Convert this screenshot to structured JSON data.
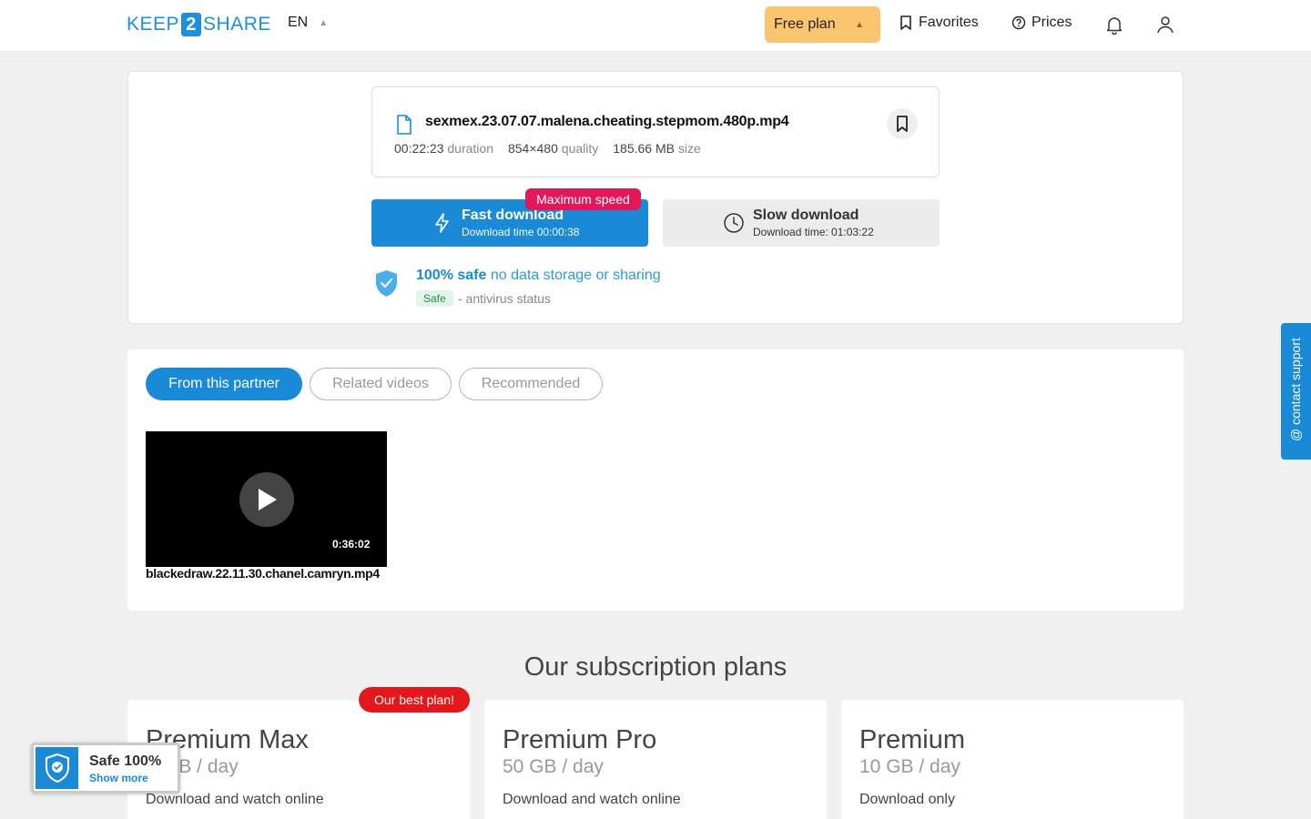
{
  "header": {
    "logo_left": "KEEP",
    "logo_num": "2",
    "logo_right": "SHARE",
    "lang": "EN",
    "plan_label": "Free plan",
    "favorites": "Favorites",
    "prices": "Prices"
  },
  "file": {
    "name": "sexmex.23.07.07.malena.cheating.stepmom.480p.mp4",
    "duration_value": "00:22:23",
    "duration_label": "duration",
    "quality_value": "854×480",
    "quality_label": "quality",
    "size_value": "185.66 MB",
    "size_label": "size"
  },
  "download": {
    "fast_title": "Fast download",
    "fast_sub": "Download time 00:00:38",
    "max_badge": "Maximum speed",
    "slow_title": "Slow download",
    "slow_sub": "Download time: 01:03:22"
  },
  "safety": {
    "bold": "100% safe",
    "rest": "no data storage or sharing",
    "tag": "Safe",
    "status": "- antivirus status"
  },
  "tabs": [
    {
      "label": "From this partner",
      "active": true
    },
    {
      "label": "Related videos",
      "active": false
    },
    {
      "label": "Recommended",
      "active": false
    }
  ],
  "video": {
    "duration": "0:36:02",
    "title": "blackedraw.22.11.30.chanel.camryn.mp4"
  },
  "plans": {
    "title": "Our subscription plans",
    "best_badge": "Our best plan!",
    "items": [
      {
        "name": "Premium Max",
        "quota": "GB / day",
        "desc": "Download and watch online"
      },
      {
        "name": "Premium Pro",
        "quota": "50 GB / day",
        "desc": "Download and watch online"
      },
      {
        "name": "Premium",
        "quota": "10 GB / day",
        "desc": "Download only"
      }
    ]
  },
  "contact": "@ contact support",
  "safe_widget": {
    "title": "Safe 100%",
    "link": "Show more"
  },
  "colors": {
    "primary": "#1a8ad6",
    "plan_button": "#fbc46e",
    "badge_red": "#e2185b"
  }
}
